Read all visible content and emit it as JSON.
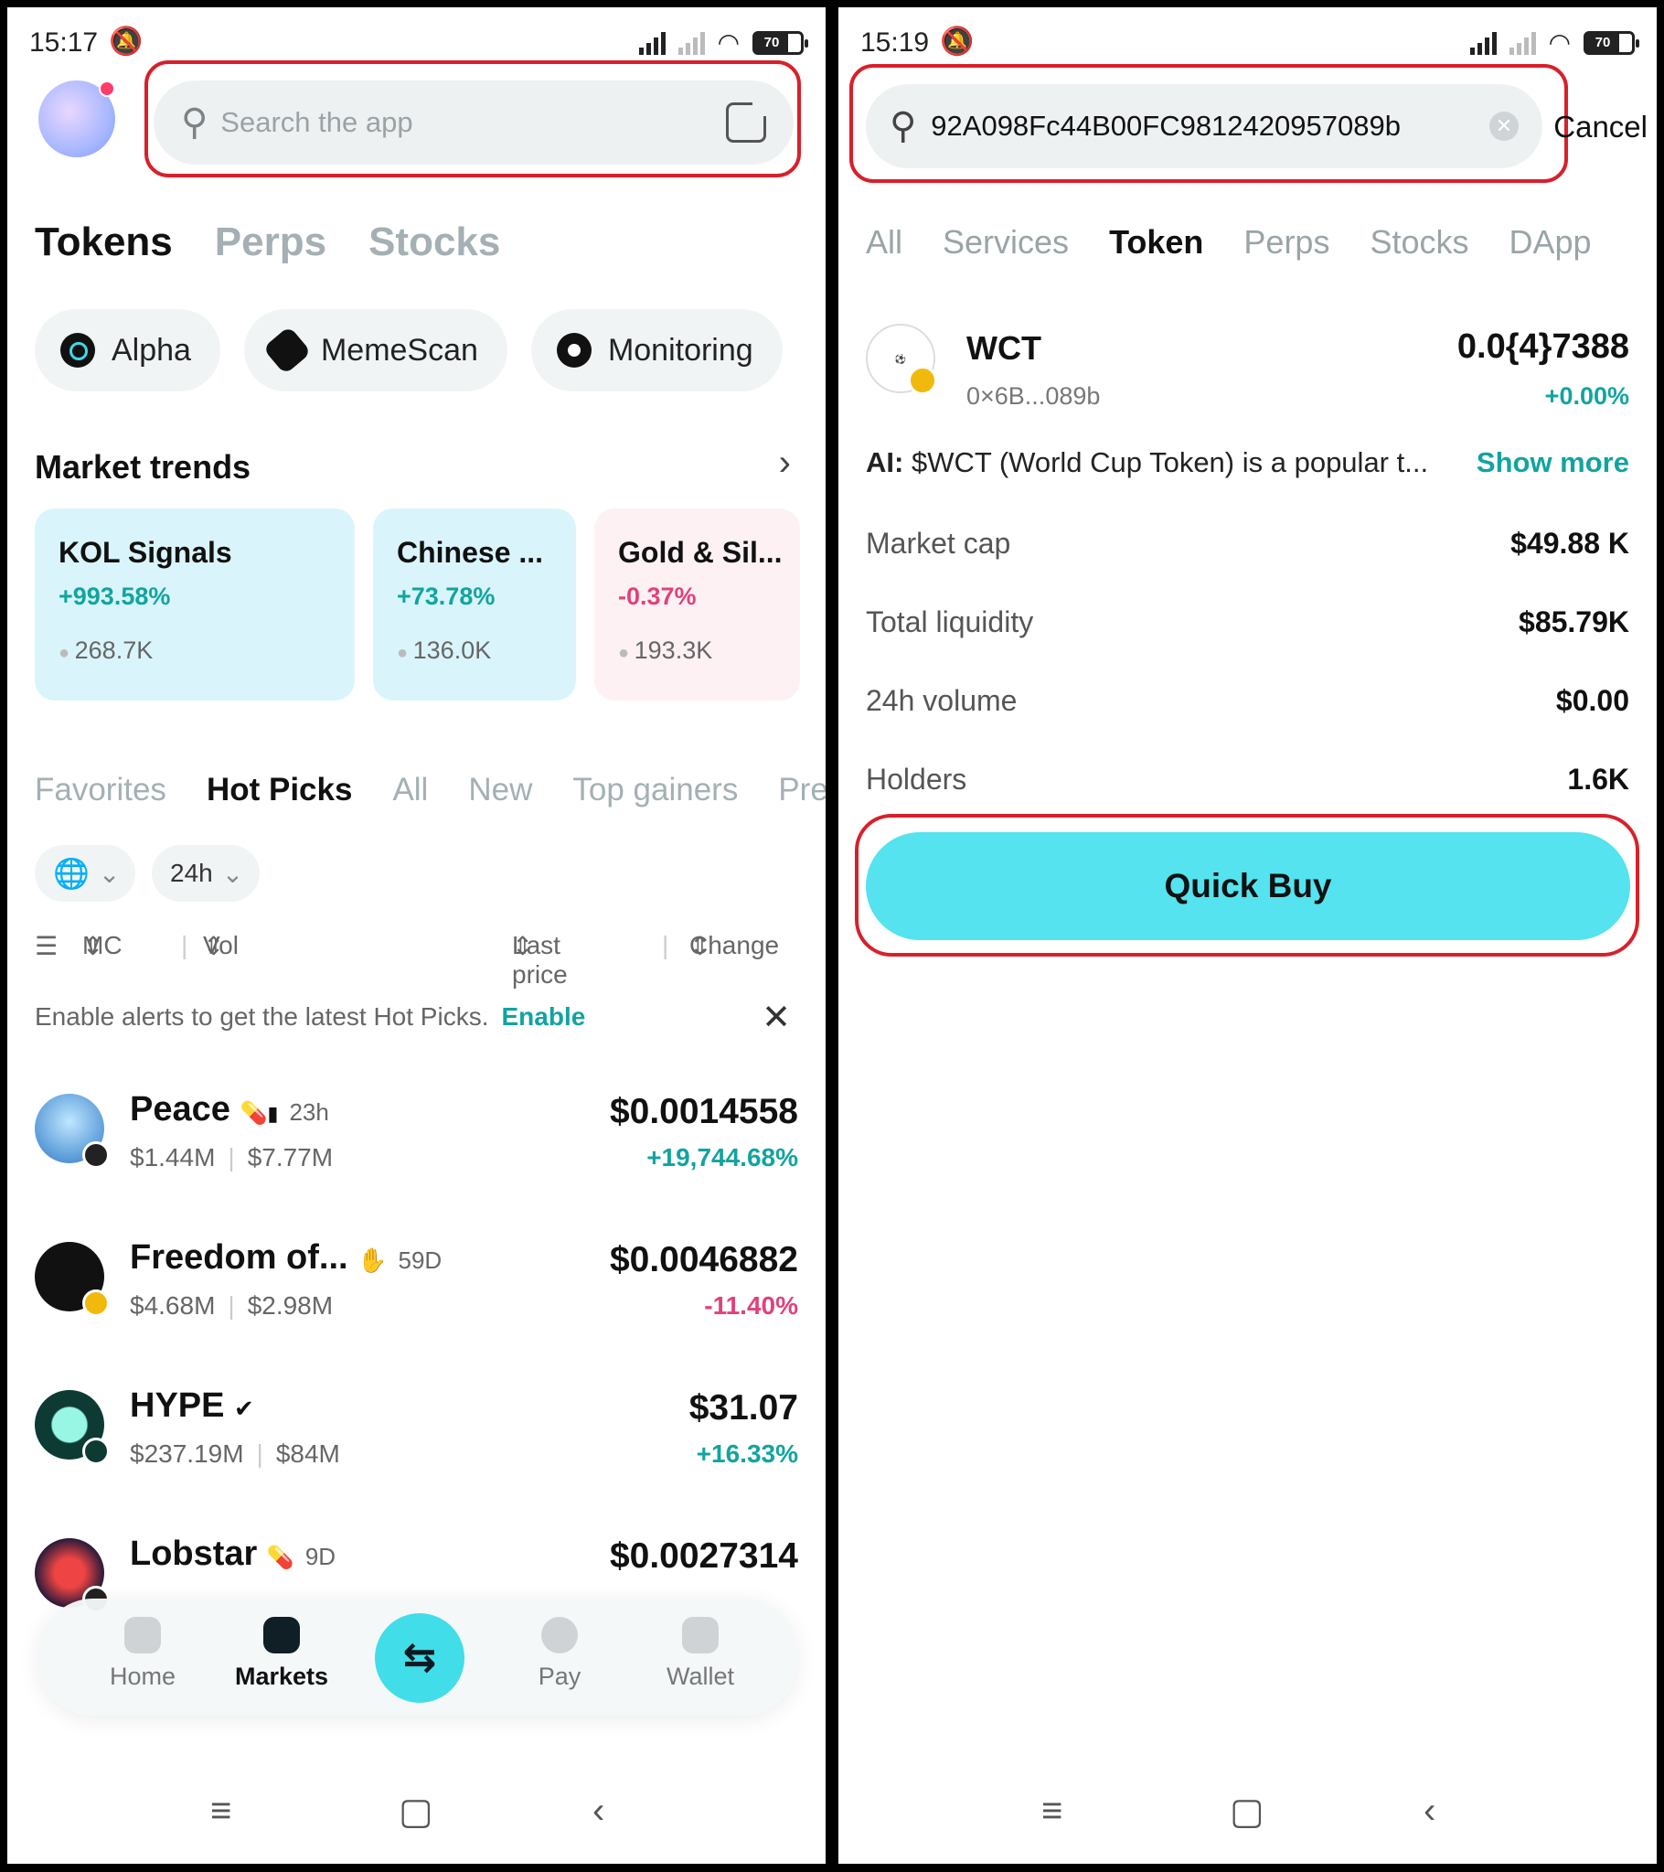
{
  "left": {
    "status": {
      "time": "15:17",
      "battery": "70"
    },
    "search": {
      "placeholder": "Search the app"
    },
    "top_tabs": [
      "Tokens",
      "Perps",
      "Stocks"
    ],
    "chips": [
      "Alpha",
      "MemeScan",
      "Monitoring"
    ],
    "market_trends": {
      "title": "Market trends",
      "cards": [
        {
          "title": "KOL Signals",
          "change": "+993.58%",
          "volume": "268.7K"
        },
        {
          "title": "Chinese ...",
          "change": "+73.78%",
          "volume": "136.0K"
        },
        {
          "title": "Gold & Sil...",
          "change": "-0.37%",
          "volume": "193.3K"
        }
      ]
    },
    "sub_tabs": [
      "Favorites",
      "Hot Picks",
      "All",
      "New",
      "Top gainers",
      "Pre"
    ],
    "filters": {
      "period": "24h"
    },
    "columns": {
      "mc": "MC",
      "vol": "Vol",
      "last_price": "Last price",
      "change": "Change"
    },
    "alert": {
      "text": "Enable alerts to get the latest Hot Picks.",
      "action": "Enable"
    },
    "tokens": [
      {
        "name": "Peace",
        "age": "23h",
        "mc": "$1.44M",
        "vol": "$7.77M",
        "price": "$0.0014558",
        "change": "+19,744.68%",
        "dir": "up"
      },
      {
        "name": "Freedom of...",
        "age": "59D",
        "mc": "$4.68M",
        "vol": "$2.98M",
        "price": "$0.0046882",
        "change": "-11.40%",
        "dir": "down"
      },
      {
        "name": "HYPE",
        "age": "",
        "mc": "$237.19M",
        "vol": "$84M",
        "price": "$31.07",
        "change": "+16.33%",
        "dir": "up"
      },
      {
        "name": "Lobstar",
        "age": "9D",
        "mc": "",
        "vol": "",
        "price": "$0.0027314",
        "change": "",
        "dir": "up"
      }
    ],
    "tabbar": {
      "home": "Home",
      "markets": "Markets",
      "pay": "Pay",
      "wallet": "Wallet"
    }
  },
  "right": {
    "status": {
      "time": "15:19",
      "battery": "70"
    },
    "search": {
      "value": "92A098Fc44B00FC9812420957089b"
    },
    "cancel": "Cancel",
    "tabs": [
      "All",
      "Services",
      "Token",
      "Perps",
      "Stocks",
      "DApp"
    ],
    "token": {
      "name": "WCT",
      "address": "0×6B...089b",
      "price": "0.0{4}7388",
      "change": "+0.00%"
    },
    "ai": {
      "label": "AI:",
      "text": "$WCT (World Cup Token) is a popular t...",
      "more": "Show more"
    },
    "stats": [
      {
        "k": "Market cap",
        "v": "$49.88 K"
      },
      {
        "k": "Total liquidity",
        "v": "$85.79K"
      },
      {
        "k": "24h volume",
        "v": "$0.00"
      },
      {
        "k": "Holders",
        "v": "1.6K"
      }
    ],
    "quick_buy": "Quick Buy"
  },
  "colors": {
    "accent": "#41dde9",
    "up": "#12a4a0",
    "down": "#e0427a",
    "highlight": "#d8202a"
  }
}
